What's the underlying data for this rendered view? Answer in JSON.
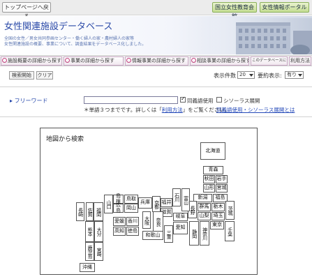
{
  "topbar": {
    "back_label": "トップページへ戻る",
    "portal1_label": "国立女性教育会館",
    "portal2_label": "女性情報ポータル"
  },
  "hero": {
    "title": "女性関連施設データベース",
    "subtitle1": "全国の女性／男女共同参画センター・働く婦人の家・農村婦人の家等",
    "subtitle2": "女性関連施設の概要、事業について、調査結果をデータベース化しました。"
  },
  "nav": {
    "tabs": [
      "施設概要の詳細から探す",
      "事業の詳細から探す",
      "情報事業の詳細から探す",
      "相談事業の詳細から探す",
      "このデータベースについて",
      "利用方法"
    ]
  },
  "controls": {
    "search_label": "検索開始",
    "clear_label": "クリア",
    "count_label": "表示件数",
    "count_value": "20",
    "summary_label": "要約表示:",
    "summary_value": "有り"
  },
  "keyword": {
    "label": "フリーワード",
    "value": "",
    "synonym_label": "同義語使用",
    "synonym_checked": true,
    "thesaurus_label": "シソーラス展開",
    "thesaurus_checked": false,
    "note_prefix": "＊単語３つまでです。詳しくは「",
    "note_link": "利用方法",
    "note_suffix": "」をご覧ください。",
    "help_link": "同義語使用・シソーラス展開とは"
  },
  "map": {
    "title": "地図から検索",
    "prefectures": {
      "hokkaido": "北海道",
      "aomori": "青森",
      "akita": "秋田",
      "iwate": "岩手",
      "yamagata": "山形",
      "miyagi": "宮城",
      "niigata": "新潟",
      "fukushima": "福島",
      "nagano": "長野",
      "gunma": "群馬",
      "tochigi": "栃木",
      "ibaraki": "茨城",
      "yamanashi": "山梨",
      "saitama": "埼玉",
      "tokyo": "東京",
      "chiba": "千葉",
      "kanagawa": "神奈川",
      "shizuoka": "静岡",
      "toyama": "富山",
      "ishikawa": "石川",
      "fukui": "福井",
      "gifu": "岐阜",
      "aichi": "愛知",
      "mie": "三重",
      "shiga": "滋賀",
      "kyoto": "京都",
      "hyogo": "兵庫",
      "osaka": "大阪",
      "nara": "奈良",
      "wakayama": "和歌山",
      "tottori": "鳥取",
      "shimane": "島根",
      "okayama": "岡山",
      "hiroshima": "広島",
      "yamaguchi": "山口",
      "kagawa": "香川",
      "ehime": "愛媛",
      "tokushima": "徳島",
      "kochi": "高知",
      "fukuoka": "福岡",
      "saga": "佐賀",
      "nagasaki": "長崎",
      "oita": "大分",
      "kumamoto": "熊本",
      "miyazaki": "宮崎",
      "kagoshima": "鹿児島",
      "okinawa": "沖縄"
    }
  },
  "colors": {
    "title_blue": "#2b4aa8",
    "link_blue": "#2348b8",
    "nav_icon_pink": "#c0407c",
    "portal_green": "#c5dd93"
  }
}
